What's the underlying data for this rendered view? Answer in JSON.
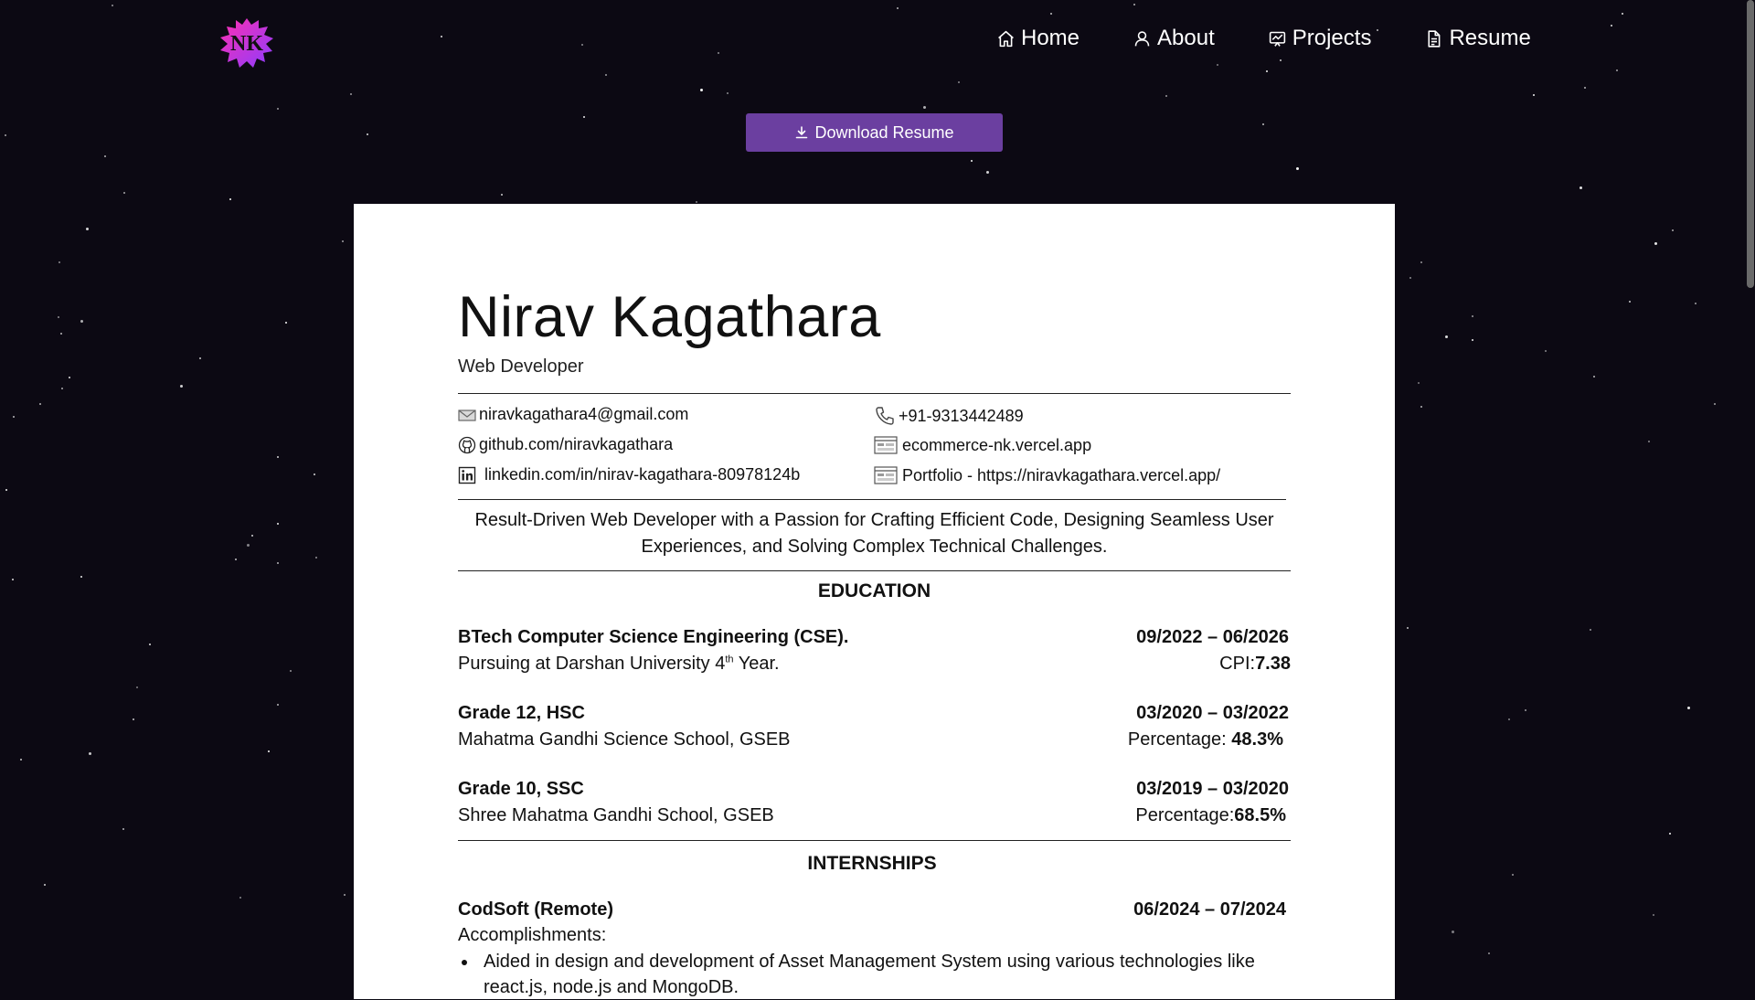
{
  "nav": {
    "logo_text": "NK",
    "items": [
      {
        "label": "Home",
        "icon": "home-icon"
      },
      {
        "label": "About",
        "icon": "user-icon"
      },
      {
        "label": "Projects",
        "icon": "projects-icon"
      },
      {
        "label": "Resume",
        "icon": "document-icon"
      }
    ]
  },
  "download_button": {
    "label": "Download Resume",
    "icon": "download-icon"
  },
  "resume": {
    "name": "Nirav Kagathara",
    "role": "Web Developer",
    "contacts": {
      "email": "niravkagathara4@gmail.com",
      "phone": "+91-9313442489",
      "github": "github.com/niravkagathara",
      "site": "ecommerce-nk.vercel.app",
      "linkedin": "linkedin.com/in/nirav-kagathara-80978124b",
      "portfolio": "Portfolio - https://niravkagathara.vercel.app/"
    },
    "summary": "Result-Driven Web Developer with a Passion for Crafting Efficient Code, Designing Seamless User Experiences, and Solving Complex Technical Challenges.",
    "education": {
      "title": "EDUCATION",
      "entries": [
        {
          "degree": "BTech Computer Science Engineering (CSE).",
          "dates": "09/2022 – 06/2026",
          "detail_prefix": "Pursuing at Darshan University 4",
          "detail_sup": "th",
          "detail_suffix": " Year.",
          "score_label": "CPI:",
          "score_value": "7.38"
        },
        {
          "degree": "Grade 12, HSC",
          "dates": "03/2020 – 03/2022",
          "detail": "Mahatma Gandhi Science School, GSEB",
          "score_label": "Percentage: ",
          "score_value": "48.3%"
        },
        {
          "degree": "Grade 10, SSC",
          "dates": "03/2019 – 03/2020",
          "detail": "Shree Mahatma Gandhi School, GSEB",
          "score_label": "Percentage:",
          "score_value": "68.5%"
        }
      ]
    },
    "internships": {
      "title": "INTERNSHIPS",
      "company": "CodSoft (Remote)",
      "dates": "06/2024 – 07/2024",
      "accomplishments_label": "Accomplishments:",
      "bullets": [
        "Aided in design and development of Asset Management System using various technologies like react.js, node.js and MongoDB."
      ]
    }
  }
}
